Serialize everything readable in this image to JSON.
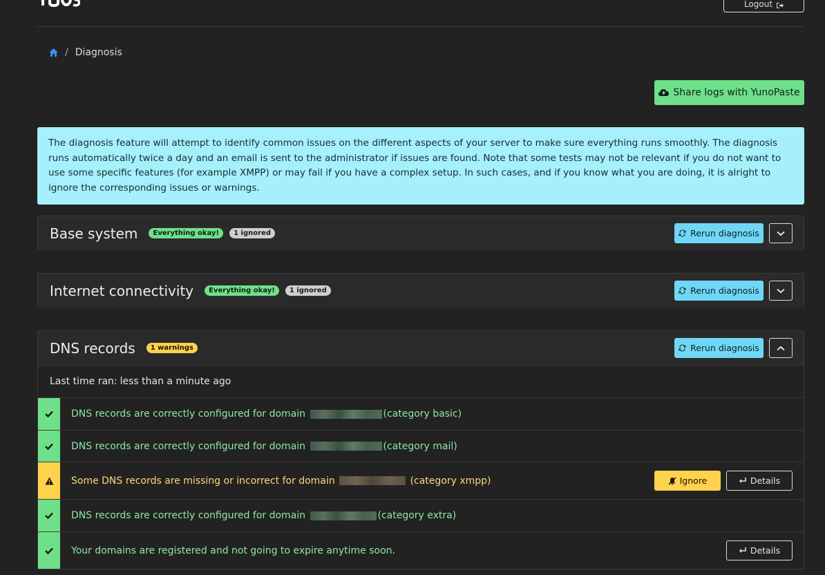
{
  "header": {
    "logo_text": "YUNOHOST",
    "logout_label": "Logout"
  },
  "breadcrumb": {
    "current": "Diagnosis"
  },
  "actions": {
    "share_label": "Share logs with YunoPaste"
  },
  "info": {
    "text": "The diagnosis feature will attempt to identify common issues on the different aspects of your server to make sure everything runs smoothly. The diagnosis runs automatically twice a day and an email is sent to the administrator if issues are found. Note that some tests may not be relevant if you do not want to use some specific features (for example XMPP) or may fail if you have a complex setup. In such cases, and if you know what you are doing, it is alright to ignore the corresponding issues or warnings."
  },
  "categories": [
    {
      "title": "Base system",
      "badge_ok": "Everything okay!",
      "badge_ignored": "1 ignored",
      "rerun_label": "Rerun diagnosis"
    },
    {
      "title": "Internet connectivity",
      "badge_ok": "Everything okay!",
      "badge_ignored": "1 ignored",
      "rerun_label": "Rerun diagnosis"
    },
    {
      "title": "DNS records",
      "badge_warning": "1 warnings",
      "rerun_label": "Rerun diagnosis",
      "last_ran_label": "Last time ran:",
      "last_ran_value": "less than a minute ago",
      "items": [
        {
          "status": "success",
          "prefix": "DNS records are correctly configured for domain",
          "suffix": "(category basic)"
        },
        {
          "status": "success",
          "prefix": "DNS records are correctly configured for domain",
          "suffix": "(category mail)"
        },
        {
          "status": "warning",
          "prefix": "Some DNS records are missing or incorrect for domain",
          "suffix": "(category xmpp)",
          "ignore_label": "Ignore",
          "details_label": "Details"
        },
        {
          "status": "success",
          "prefix": "DNS records are correctly configured for domain",
          "suffix": "(category extra)"
        },
        {
          "status": "success",
          "text": "Your domains are registered and not going to expire anytime soon.",
          "details_label": "Details"
        }
      ]
    }
  ],
  "colors": {
    "background": "#222222",
    "success": "#6fe08a",
    "info": "#6fd7f5",
    "warning": "#ffd24d",
    "info_box": "#a5f0fb"
  }
}
